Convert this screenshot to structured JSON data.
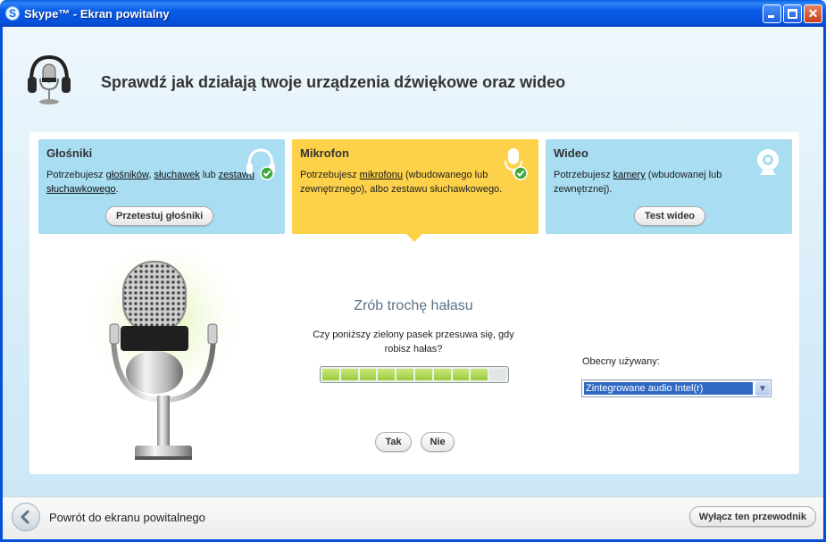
{
  "window": {
    "title": "Skype™ - Ekran powitalny",
    "logo_letter": "S"
  },
  "header": {
    "title": "Sprawdź jak działają twoje urządzenia dźwiękowe oraz wideo",
    "icon": "headset-icon"
  },
  "cards": {
    "speakers": {
      "title": "Głośniki",
      "text_prefix": "Potrzebujesz ",
      "link1": "głośników",
      "sep1": ", ",
      "link2": "słuchawek",
      "sep2": " lub ",
      "link3": "zestawu słuchawkowego",
      "text_suffix": ".",
      "button": "Przetestuj głośniki",
      "icon": "headphones-check-icon"
    },
    "microphone": {
      "title": "Mikrofon",
      "text_prefix": "Potrzebujesz ",
      "link1": "mikrofonu",
      "text_suffix": " (wbudowanego lub zewnętrznego), albo zestawu słuchawkowego.",
      "icon": "microphone-check-icon"
    },
    "video": {
      "title": "Wideo",
      "text_prefix": "Potrzebujesz ",
      "link1": "kamery",
      "text_suffix": " (wbudowanej lub zewnętrznej).",
      "button": "Test wideo",
      "icon": "webcam-icon"
    }
  },
  "mic_test": {
    "title": "Zrób trochę hałasu",
    "question": "Czy poniższy zielony pasek przesuwa się, gdy robisz hałas?",
    "level": 0.9,
    "segments_total": 10,
    "segments_lit": 9,
    "yes_label": "Tak",
    "no_label": "Nie"
  },
  "device": {
    "label": "Obecny używany:",
    "selected": "Zintegrowane audio Intel(r)"
  },
  "footer": {
    "back_label": "Powrót do ekranu powitalnego",
    "exit_label": "Wyłącz ten przewodnik"
  },
  "colors": {
    "title_bar": "#0550d9",
    "card_blue": "#a8ddf2",
    "card_yellow": "#fdd24a",
    "level_green": "#9ccb3e",
    "selection_blue": "#316ac5"
  }
}
